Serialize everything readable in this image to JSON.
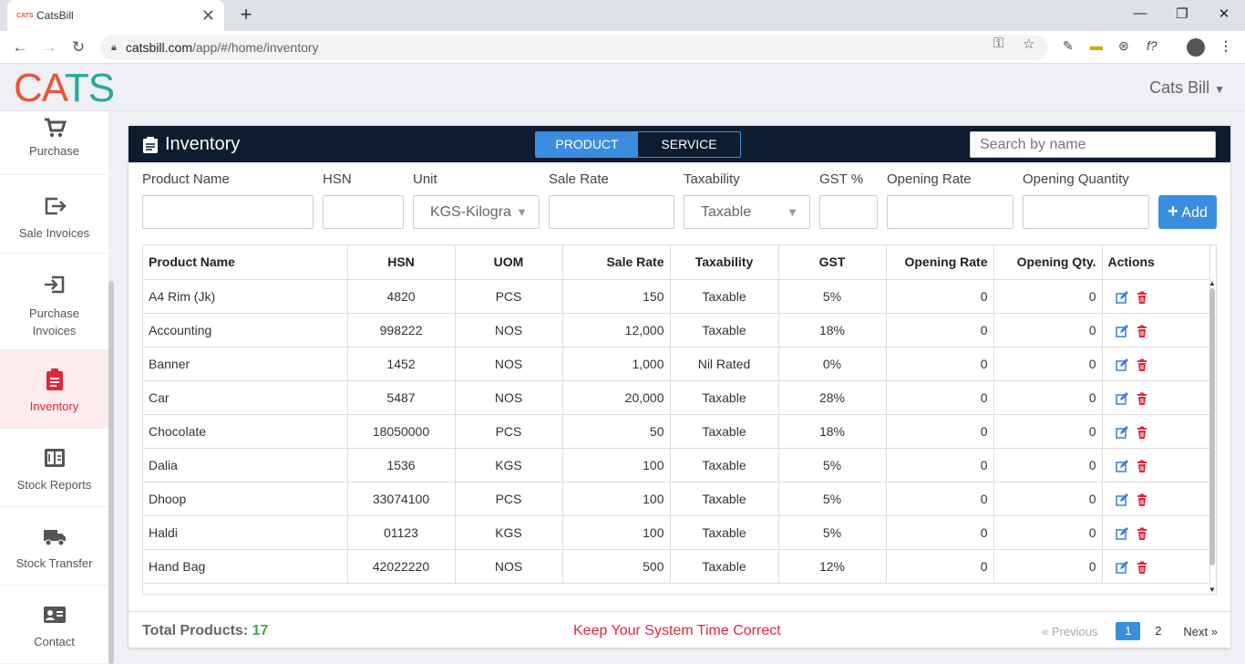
{
  "browser": {
    "tab_favicon": "CATS",
    "tab_title": "CatsBill",
    "url_host": "catsbill.com",
    "url_path": "/app/#/home/inventory"
  },
  "app": {
    "logo": [
      "C",
      "A",
      "T",
      "S"
    ],
    "user_name": "Cats Bill"
  },
  "sidebar": {
    "items": [
      {
        "label": "Purchase",
        "icon": "cart-icon"
      },
      {
        "label": "Sale Invoices",
        "icon": "sign-out-icon"
      },
      {
        "label": "Purchase Invoices",
        "icon": "sign-in-icon"
      },
      {
        "label": "Inventory",
        "icon": "clipboard-icon",
        "active": true
      },
      {
        "label": "Stock Reports",
        "icon": "calculator-icon"
      },
      {
        "label": "Stock Transfer",
        "icon": "truck-icon"
      },
      {
        "label": "Contact",
        "icon": "contact-card-icon"
      }
    ]
  },
  "panel": {
    "title": "Inventory",
    "seg_product": "PRODUCT",
    "seg_service": "SERVICE",
    "search_placeholder": "Search by name"
  },
  "form": {
    "labels": {
      "product_name": "Product Name",
      "hsn": "HSN",
      "unit": "Unit",
      "sale_rate": "Sale Rate",
      "taxability": "Taxability",
      "gst": "GST %",
      "opening_rate": "Opening Rate",
      "opening_qty": "Opening Quantity"
    },
    "unit_value": "KGS-Kilogra",
    "taxability_value": "Taxable",
    "add_label": "Add"
  },
  "table": {
    "headers": [
      "Product Name",
      "HSN",
      "UOM",
      "Sale Rate",
      "Taxability",
      "GST",
      "Opening Rate",
      "Opening Qty.",
      "Actions"
    ],
    "rows": [
      [
        "A4 Rim (Jk)",
        "4820",
        "PCS",
        "150",
        "Taxable",
        "5%",
        "0",
        "0"
      ],
      [
        "Accounting",
        "998222",
        "NOS",
        "12,000",
        "Taxable",
        "18%",
        "0",
        "0"
      ],
      [
        "Banner",
        "1452",
        "NOS",
        "1,000",
        "Nil Rated",
        "0%",
        "0",
        "0"
      ],
      [
        "Car",
        "5487",
        "NOS",
        "20,000",
        "Taxable",
        "28%",
        "0",
        "0"
      ],
      [
        "Chocolate",
        "18050000",
        "PCS",
        "50",
        "Taxable",
        "18%",
        "0",
        "0"
      ],
      [
        "Dalia",
        "1536",
        "KGS",
        "100",
        "Taxable",
        "5%",
        "0",
        "0"
      ],
      [
        "Dhoop",
        "33074100",
        "PCS",
        "100",
        "Taxable",
        "5%",
        "0",
        "0"
      ],
      [
        "Haldi",
        "01123",
        "KGS",
        "100",
        "Taxable",
        "5%",
        "0",
        "0"
      ],
      [
        "Hand Bag",
        "42022220",
        "NOS",
        "500",
        "Taxable",
        "12%",
        "0",
        "0"
      ]
    ]
  },
  "footer": {
    "total_label": "Total Products:",
    "total_value": "17",
    "warning": "Keep Your System Time Correct",
    "prev": "« Previous",
    "pages": [
      "1",
      "2"
    ],
    "next": "Next »"
  }
}
